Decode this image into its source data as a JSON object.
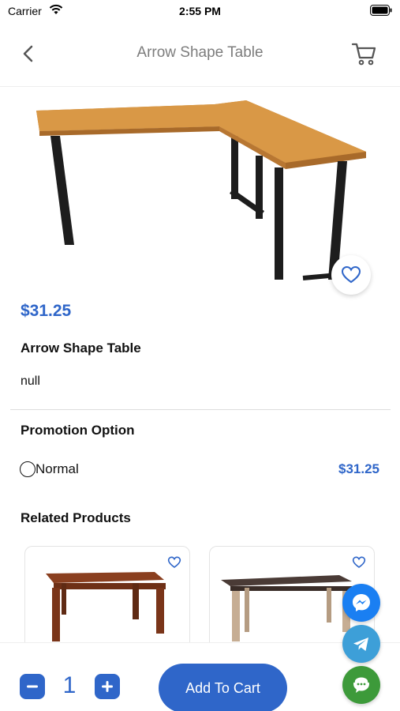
{
  "status_bar": {
    "carrier": "Carrier",
    "time": "2:55 PM"
  },
  "header": {
    "title": "Arrow Shape Table",
    "back_icon": "chevron-left-icon",
    "cart_icon": "cart-icon"
  },
  "product": {
    "price": "$31.25",
    "name": "Arrow Shape Table",
    "description": "null",
    "wishlist_icon": "heart-outline-icon"
  },
  "promotion": {
    "title": "Promotion Option",
    "options": [
      {
        "label": "Normal",
        "price": "$31.25",
        "selected": false
      }
    ]
  },
  "related": {
    "title": "Related Products",
    "items": [
      {
        "icon": "heart-outline-icon"
      },
      {
        "icon": "heart-outline-icon"
      }
    ]
  },
  "cart_bar": {
    "quantity": "1",
    "add_label": "Add To Cart"
  },
  "colors": {
    "accent": "#2f66c9",
    "messenger": "#1a7ff2",
    "telegram": "#3d9fd8",
    "support": "#3d9a3a"
  }
}
